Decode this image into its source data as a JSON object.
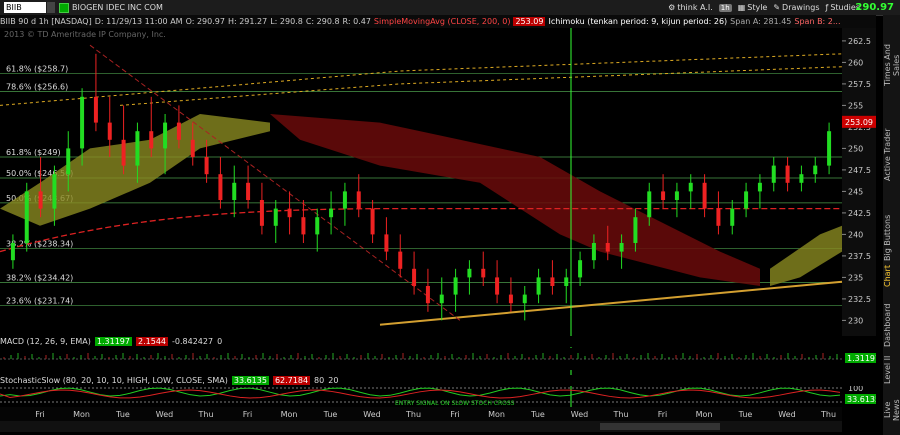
{
  "symbol": "BIIB",
  "company": "BIOGEN IDEC INC COM",
  "last_price": "290.97",
  "header": {
    "desc": "BIIB 90 d 1h [NASDAQ]",
    "date": "D: 11/29/13 11:00 AM",
    "open": "O: 290.97",
    "high": "H: 291.27",
    "low": "L: 290.8",
    "close": "C: 290.8",
    "range": "R: 0.47",
    "sma": "SimpleMovingAvg (CLOSE, 200, 0)",
    "sma_val": "253.09",
    "ichi": "Ichimoku (tenkan period: 9, kijun period: 26)",
    "span_a": "Span A: 281.45",
    "span_b": "Span B: 2..."
  },
  "menu": {
    "think": "think A.I.",
    "interval_badge": "1h",
    "style": "Style",
    "drawings": "Drawings",
    "studies": "Studies"
  },
  "copyright": "2013 © TD Ameritrade IP Company, Inc.",
  "fib_labels": [
    {
      "text": "61.8% ($258.7)",
      "price": 258.7
    },
    {
      "text": "78.6% ($256.6)",
      "price": 256.6
    },
    {
      "text": "61.8% ($249)",
      "price": 249.0
    },
    {
      "text": "50.0% ($246.56)",
      "price": 246.56
    },
    {
      "text": "50.0% ($243.67)",
      "price": 243.67
    },
    {
      "text": "38.2% ($238.34)",
      "price": 238.34
    },
    {
      "text": "38.2% ($234.42)",
      "price": 234.42
    },
    {
      "text": "23.6% ($231.74)",
      "price": 231.74
    }
  ],
  "price_ticks": [
    "262.5",
    "260",
    "257.5",
    "255",
    "252.5",
    "250",
    "247.5",
    "245",
    "242.5",
    "240",
    "237.5",
    "235",
    "232.5",
    "230"
  ],
  "price_marker": "253.09",
  "macd": {
    "label": "MACD (12, 26, 9, EMA)",
    "v1": "1.31197",
    "v2": "2.1544",
    "v3": "-0.842427",
    "v4": "0",
    "tag": "1.31197"
  },
  "stoch": {
    "label": "StochasticSlow (80, 20, 10, 10, HIGH, LOW, CLOSE, SMA)",
    "v1": "33.6135",
    "v2": "62.7184",
    "v3": "80",
    "v4": "20",
    "tick": "100",
    "tag": "33.6135",
    "note": "ENTRY SIGNAL ON SLOW STOCH CROSS"
  },
  "time_labels": [
    "Fri",
    "Mon",
    "Tue",
    "Wed",
    "Thu",
    "Fri",
    "Mon",
    "Tue",
    "Wed",
    "Thu",
    "Fri",
    "Mon",
    "Tue",
    "Wed",
    "Thu",
    "Fri",
    "Mon",
    "Tue",
    "Wed",
    "Thu"
  ],
  "side_tabs": [
    "Times And Sales",
    "Active Trader",
    "Big Buttons",
    "Chart",
    "Dashboard",
    "Level II",
    "Live News"
  ],
  "colors": {
    "up": "#22dd22",
    "down": "#ee2222",
    "accent": "#33ff33",
    "cloud_red": "#6a0a0a",
    "cloud_olive": "#8a8a20"
  },
  "chart_data": {
    "type": "candlestick",
    "ylim": [
      229,
      264
    ],
    "candles": [
      [
        237,
        240,
        236,
        239
      ],
      [
        239,
        246,
        238,
        245
      ],
      [
        245,
        249,
        242,
        243
      ],
      [
        243,
        248,
        241,
        247
      ],
      [
        247,
        252,
        245,
        250
      ],
      [
        250,
        257,
        248,
        256
      ],
      [
        256,
        261,
        252,
        253
      ],
      [
        253,
        256,
        249,
        251
      ],
      [
        251,
        255,
        247,
        248
      ],
      [
        248,
        253,
        246,
        252
      ],
      [
        252,
        256,
        249,
        250
      ],
      [
        250,
        254,
        247,
        253
      ],
      [
        253,
        255,
        250,
        251
      ],
      [
        251,
        253,
        248,
        249
      ],
      [
        249,
        251,
        246,
        247
      ],
      [
        247,
        249,
        243,
        244
      ],
      [
        244,
        248,
        242,
        246
      ],
      [
        246,
        248,
        243,
        244
      ],
      [
        244,
        246,
        240,
        241
      ],
      [
        241,
        244,
        239,
        243
      ],
      [
        243,
        245,
        240,
        242
      ],
      [
        242,
        244,
        239,
        240
      ],
      [
        240,
        243,
        238,
        242
      ],
      [
        242,
        245,
        240,
        243
      ],
      [
        243,
        246,
        241,
        245
      ],
      [
        245,
        247,
        242,
        243
      ],
      [
        243,
        244,
        239,
        240
      ],
      [
        240,
        242,
        237,
        238
      ],
      [
        238,
        240,
        235,
        236
      ],
      [
        236,
        238,
        233,
        234
      ],
      [
        234,
        236,
        231,
        232
      ],
      [
        232,
        235,
        230,
        233
      ],
      [
        233,
        236,
        231,
        235
      ],
      [
        235,
        237,
        233,
        236
      ],
      [
        236,
        238,
        234,
        235
      ],
      [
        235,
        237,
        232,
        233
      ],
      [
        233,
        235,
        231,
        232
      ],
      [
        232,
        234,
        230,
        233
      ],
      [
        233,
        236,
        232,
        235
      ],
      [
        235,
        237,
        233,
        234
      ],
      [
        234,
        236,
        232,
        235
      ],
      [
        235,
        238,
        234,
        237
      ],
      [
        237,
        240,
        236,
        239
      ],
      [
        239,
        241,
        237,
        238
      ],
      [
        238,
        240,
        236,
        239
      ],
      [
        239,
        243,
        238,
        242
      ],
      [
        242,
        246,
        241,
        245
      ],
      [
        245,
        247,
        243,
        244
      ],
      [
        244,
        246,
        242,
        245
      ],
      [
        245,
        247,
        243,
        246
      ],
      [
        246,
        247,
        242,
        243
      ],
      [
        243,
        245,
        240,
        241
      ],
      [
        241,
        244,
        240,
        243
      ],
      [
        243,
        246,
        242,
        245
      ],
      [
        245,
        247,
        243,
        246
      ],
      [
        246,
        249,
        245,
        248
      ],
      [
        248,
        249,
        245,
        246
      ],
      [
        246,
        248,
        245,
        247
      ],
      [
        247,
        249,
        246,
        248
      ],
      [
        248,
        253,
        247,
        252
      ]
    ]
  }
}
